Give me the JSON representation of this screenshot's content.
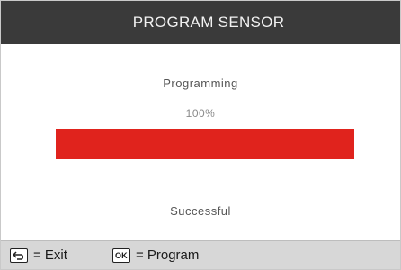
{
  "header": {
    "title": "PROGRAM SENSOR"
  },
  "main": {
    "status": "Programming",
    "percent_label": "100%",
    "progress_fraction": 1.0,
    "progress_color": "#e0231d",
    "result": "Successful"
  },
  "footer": {
    "exit_icon": "back-arrow-icon",
    "exit_label": "= Exit",
    "ok_key": "OK",
    "program_label": "= Program"
  }
}
